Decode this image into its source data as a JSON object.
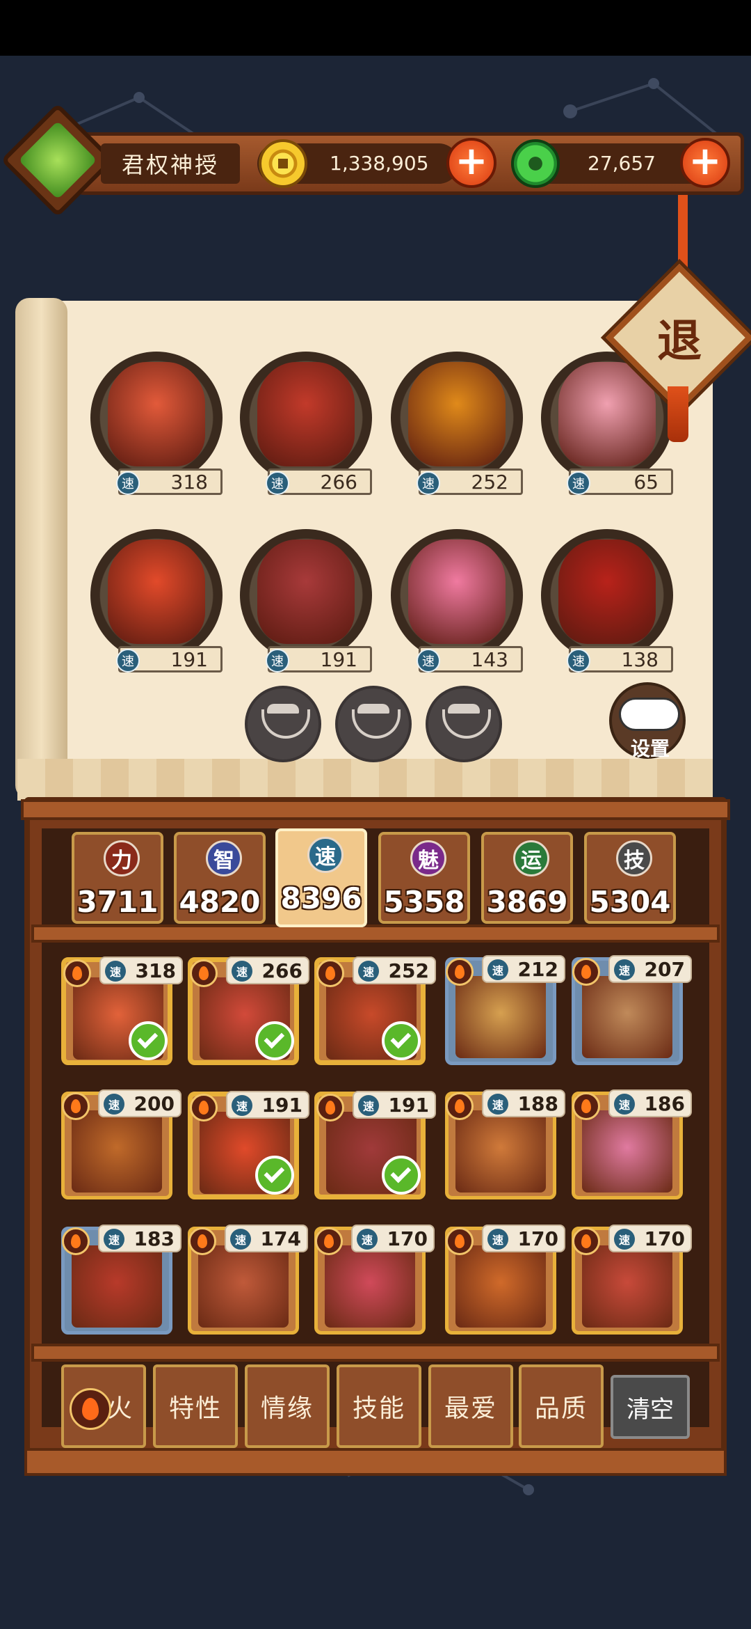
{
  "header": {
    "player_title": "君权神授",
    "gold": "1,338,905",
    "jade": "27,657",
    "exit_label": "退"
  },
  "roster": [
    {
      "speed": "318",
      "color": "#e25a3a"
    },
    {
      "speed": "266",
      "color": "#c23a2a"
    },
    {
      "speed": "252",
      "color": "#e08a1a"
    },
    {
      "speed": "65",
      "color": "#f0a0b0"
    },
    {
      "speed": "191",
      "color": "#e24a2a"
    },
    {
      "speed": "191",
      "color": "#a83a3a"
    },
    {
      "speed": "143",
      "color": "#f07aa0"
    },
    {
      "speed": "138",
      "color": "#b8221a"
    }
  ],
  "settings_label": "设置",
  "speed_icon": "速",
  "stats": [
    {
      "icon": "力",
      "value": "3711",
      "color": "#8a2a1a"
    },
    {
      "icon": "智",
      "value": "4820",
      "color": "#3a4a9a"
    },
    {
      "icon": "速",
      "value": "8396",
      "color": "#2a6a8a"
    },
    {
      "icon": "魅",
      "value": "5358",
      "color": "#7a2a8a"
    },
    {
      "icon": "运",
      "value": "3869",
      "color": "#2a7a3a"
    },
    {
      "icon": "技",
      "value": "5304",
      "color": "#4a4a4a"
    }
  ],
  "cards": [
    {
      "speed": "318",
      "selected": true,
      "frame": "gold",
      "color": "#e2623a"
    },
    {
      "speed": "266",
      "selected": true,
      "frame": "gold",
      "color": "#d24a3a"
    },
    {
      "speed": "252",
      "selected": true,
      "frame": "gold",
      "color": "#c84a2a"
    },
    {
      "speed": "212",
      "selected": false,
      "frame": "blue",
      "color": "#d6a050"
    },
    {
      "speed": "207",
      "selected": false,
      "frame": "blue",
      "color": "#c08a5a"
    },
    {
      "speed": "200",
      "selected": false,
      "frame": "gold",
      "color": "#c06a2a"
    },
    {
      "speed": "191",
      "selected": true,
      "frame": "gold",
      "color": "#e04a2a"
    },
    {
      "speed": "191",
      "selected": true,
      "frame": "gold",
      "color": "#a03a3a"
    },
    {
      "speed": "188",
      "selected": false,
      "frame": "gold",
      "color": "#d07a3a"
    },
    {
      "speed": "186",
      "selected": false,
      "frame": "gold",
      "color": "#e07aa0"
    },
    {
      "speed": "183",
      "selected": false,
      "frame": "blue",
      "color": "#b83a2a"
    },
    {
      "speed": "174",
      "selected": false,
      "frame": "gold",
      "color": "#c05a3a"
    },
    {
      "speed": "170",
      "selected": false,
      "frame": "gold",
      "color": "#d04a5a"
    },
    {
      "speed": "170",
      "selected": false,
      "frame": "gold",
      "color": "#d06a2a"
    },
    {
      "speed": "170",
      "selected": false,
      "frame": "gold",
      "color": "#c84a3a"
    }
  ],
  "filters": [
    {
      "label": "火"
    },
    {
      "label": "特性"
    },
    {
      "label": "情缘"
    },
    {
      "label": "技能"
    },
    {
      "label": "最爱"
    },
    {
      "label": "品质"
    }
  ],
  "clear_label": "清空"
}
